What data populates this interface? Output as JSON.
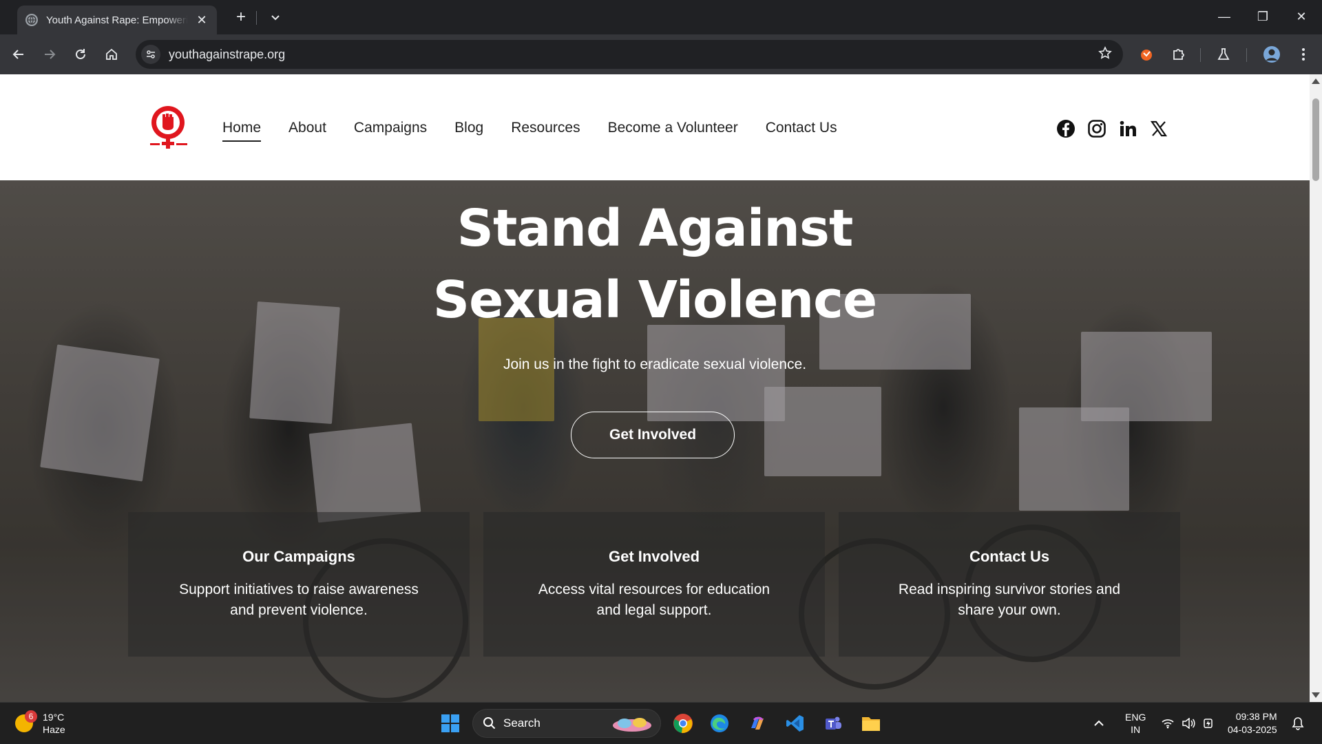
{
  "browser": {
    "tab_title": "Youth Against Rape: Empowering",
    "url": "youthagainstrape.org",
    "close_symbol": "✕",
    "new_tab_symbol": "+",
    "minimize_symbol": "—",
    "restore_symbol": "❐",
    "window_close_symbol": "✕"
  },
  "site": {
    "nav": [
      "Home",
      "About",
      "Campaigns",
      "Blog",
      "Resources",
      "Become a Volunteer",
      "Contact Us"
    ],
    "active_nav": "Home",
    "social": [
      "facebook-icon",
      "instagram-icon",
      "linkedin-icon",
      "x-icon"
    ],
    "brand_color": "#e0161e"
  },
  "hero": {
    "title": "Stand Against Sexual Violence",
    "subtitle": "Join us in the fight to eradicate sexual violence.",
    "cta": "Get Involved",
    "cards": [
      {
        "title": "Our Campaigns",
        "text": "Support initiatives to raise awareness and prevent violence."
      },
      {
        "title": "Get Involved",
        "text": "Access vital resources for education and legal support."
      },
      {
        "title": "Contact Us",
        "text": "Read inspiring survivor stories and share your own."
      }
    ]
  },
  "taskbar": {
    "weather_temp": "19°C",
    "weather_desc": "Haze",
    "notification_count": "6",
    "search_label": "Search",
    "lang_1": "ENG",
    "lang_2": "IN",
    "time": "09:38 PM",
    "date": "04-03-2025"
  }
}
